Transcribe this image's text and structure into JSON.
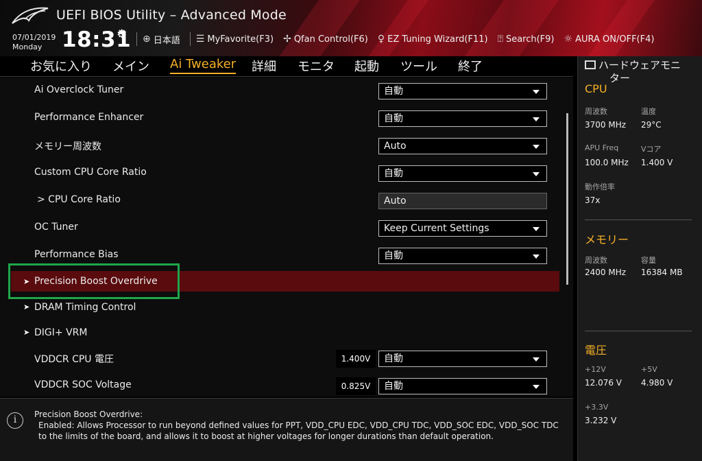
{
  "header": {
    "title": "UEFI BIOS Utility – Advanced Mode",
    "date": "07/01/2019",
    "day": "Monday",
    "time": "18:31",
    "toolbar": [
      {
        "label": "日本語",
        "icon": "globe-icon"
      },
      {
        "label": "MyFavorite(F3)",
        "icon": "favorite-list-icon"
      },
      {
        "label": "Qfan Control(F6)",
        "icon": "fan-icon"
      },
      {
        "label": "EZ Tuning Wizard(F11)",
        "icon": "lightbulb-icon"
      },
      {
        "label": "Search(F9)",
        "icon": "search-help-icon"
      },
      {
        "label": "AURA ON/OFF(F4)",
        "icon": "aura-light-icon"
      }
    ]
  },
  "menu": [
    "お気に入り",
    "メイン",
    "Ai Tweaker",
    "詳細",
    "モニタ",
    "起動",
    "ツール",
    "終了"
  ],
  "active_menu": "Ai Tweaker",
  "settings": [
    {
      "label": "Ai Overclock Tuner",
      "value": "自動"
    },
    {
      "label": "Performance Enhancer",
      "value": "自動"
    },
    {
      "label": "メモリー周波数",
      "value": "Auto"
    },
    {
      "label": "Custom CPU Core Ratio",
      "value": "自動"
    },
    {
      "label": "> CPU Core Ratio",
      "value": "Auto"
    },
    {
      "label": "OC Tuner",
      "value": "Keep Current Settings"
    },
    {
      "label": "Performance Bias",
      "value": "自動"
    },
    {
      "label": "Precision Boost Overdrive"
    },
    {
      "label": "DRAM Timing Control"
    },
    {
      "label": "DIGI+ VRM"
    },
    {
      "label": "VDDCR CPU 電圧",
      "reading": "1.400V",
      "value": "自動"
    },
    {
      "label": "VDDCR SOC Voltage",
      "reading": "0.825V",
      "value": "自動"
    }
  ],
  "help": {
    "title": "Precision Boost Overdrive:",
    "body": "Enabled: Allows Processor to run beyond defined values for PPT, VDD_CPU EDC, VDD_CPU TDC, VDD_SOC EDC, VDD_SOC TDC to the limits of the board, and allows it to boost at higher voltages for longer durations than default operation."
  },
  "monitor": {
    "title_line1": "ハードウェアモニ",
    "title_line2": "ター",
    "cpu": {
      "title": "CPU",
      "freq_label": "周波数",
      "freq": "3700 MHz",
      "temp_label": "温度",
      "temp": "29°C",
      "apu_label": "APU Freq",
      "apu": "100.0 MHz",
      "vcore_label": "Vコア",
      "vcore": "1.400 V",
      "ratio_label": "動作倍率",
      "ratio": "37x"
    },
    "memory": {
      "title": "メモリー",
      "freq_label": "周波数",
      "freq": "2400 MHz",
      "cap_label": "容量",
      "cap": "16384 MB"
    },
    "voltage": {
      "title": "電圧",
      "v12_label": "+12V",
      "v12": "12.076 V",
      "v5_label": "+5V",
      "v5": "4.980 V",
      "v33_label": "+3.3V",
      "v33": "3.232 V"
    }
  },
  "colors": {
    "accent": "#f5b027",
    "selected_row": "#5a0b0e",
    "highlight_box": "#1fa64a"
  }
}
